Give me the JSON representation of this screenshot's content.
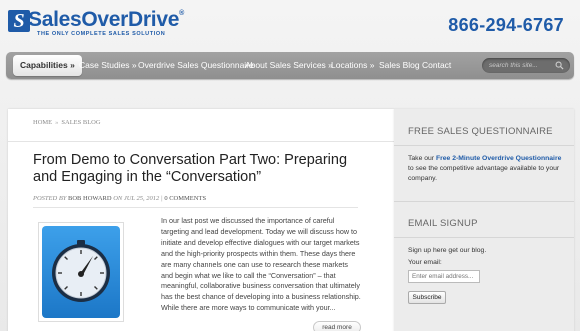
{
  "header": {
    "logo_name": "SalesOverDrive",
    "logo_tm": "®",
    "logo_tagline": "The Only Complete Sales Solution",
    "phone": "866-294-6767"
  },
  "nav": {
    "items": [
      {
        "label": "Capabilities »",
        "active": true
      },
      {
        "label": "Case Studies »"
      },
      {
        "label": "Overdrive Sales Questionnaire"
      },
      {
        "label": "About Sales Services »"
      },
      {
        "label": "Locations »"
      },
      {
        "label": "Sales Blog"
      },
      {
        "label": "Contact"
      }
    ],
    "search_placeholder": "search this site..."
  },
  "main": {
    "breadcrumb": {
      "home": "HOME",
      "separator": "»",
      "current": "SALES BLOG"
    },
    "post": {
      "title": "From Demo to Conversation Part Two: Preparing and Engaging in the “Conversation”",
      "meta_posted": "POSTED BY",
      "meta_author": "BOB HOWARD",
      "meta_on": "ON JUL 25, 2012 |",
      "meta_comments": "0 COMMENTS",
      "thumbnail_icon": "gauge-icon",
      "excerpt": "In our last post we discussed the importance of careful targeting and lead development. Today we will discuss how to initiate and develop effective dialogues with our target markets and the high-priority prospects within them. These days there are many channels one can use to research these markets and begin what we like to call the “Conversation” – that meaningful, collaborative business conversation that ultimately has the best chance of developing into a business relationship. While there are more ways to communicate with your...",
      "read_more": "read more"
    }
  },
  "sidebar": {
    "questionnaire": {
      "title": "FREE SALES QUESTIONNAIRE",
      "text_before": "Take our ",
      "text_link": "Free 2-Minute Overdrive Questionnaire",
      "text_after": " to see the competitive advantage available to your company."
    },
    "signup": {
      "title": "EMAIL SIGNUP",
      "text": "Sign up here get our blog.",
      "email_label": "Your email:",
      "email_placeholder": "Enter email address...",
      "subscribe_label": "Subscribe"
    }
  },
  "colors": {
    "brand_blue": "#1f5ba8",
    "nav_gray": "#999999",
    "thumb_blue": "#2b8ad9"
  }
}
